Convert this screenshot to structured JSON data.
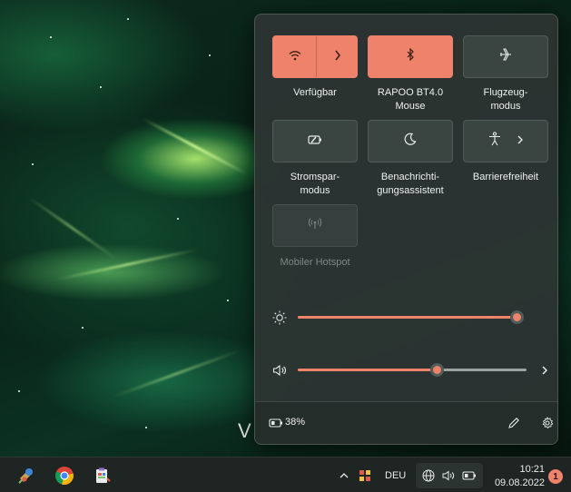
{
  "desktop": {
    "partial_text": "V"
  },
  "quick_settings": {
    "tiles": [
      {
        "label": "Verfügbar",
        "state": "active",
        "icon": "wifi-icon"
      },
      {
        "label": "RAPOO BT4.0\nMouse",
        "state": "active",
        "icon": "bluetooth-icon"
      },
      {
        "label": "Flugzeug-\nmodus",
        "state": "off",
        "icon": "airplane-icon"
      },
      {
        "label": "Stromspar-\nmodus",
        "state": "off",
        "icon": "battery-saver-icon"
      },
      {
        "label": "Benachrichti-\ngungsassistent",
        "state": "off",
        "icon": "moon-icon"
      },
      {
        "label": "Barrierefreiheit",
        "state": "off",
        "icon": "accessibility-icon"
      },
      {
        "label": "Mobiler Hotspot",
        "state": "disabled",
        "icon": "hotspot-icon"
      }
    ],
    "brightness": {
      "icon": "sun-icon",
      "level_percent": 100
    },
    "volume": {
      "icon": "speaker-icon",
      "level_percent": 60
    },
    "battery_text": "38%",
    "accent_color": "#ef826b"
  },
  "taskbar": {
    "apps": [
      "paint-icon",
      "chrome-icon",
      "clipboard-icon"
    ],
    "language": "DEU",
    "time": "10:21",
    "date": "09.08.2022",
    "notification_count": "1"
  }
}
